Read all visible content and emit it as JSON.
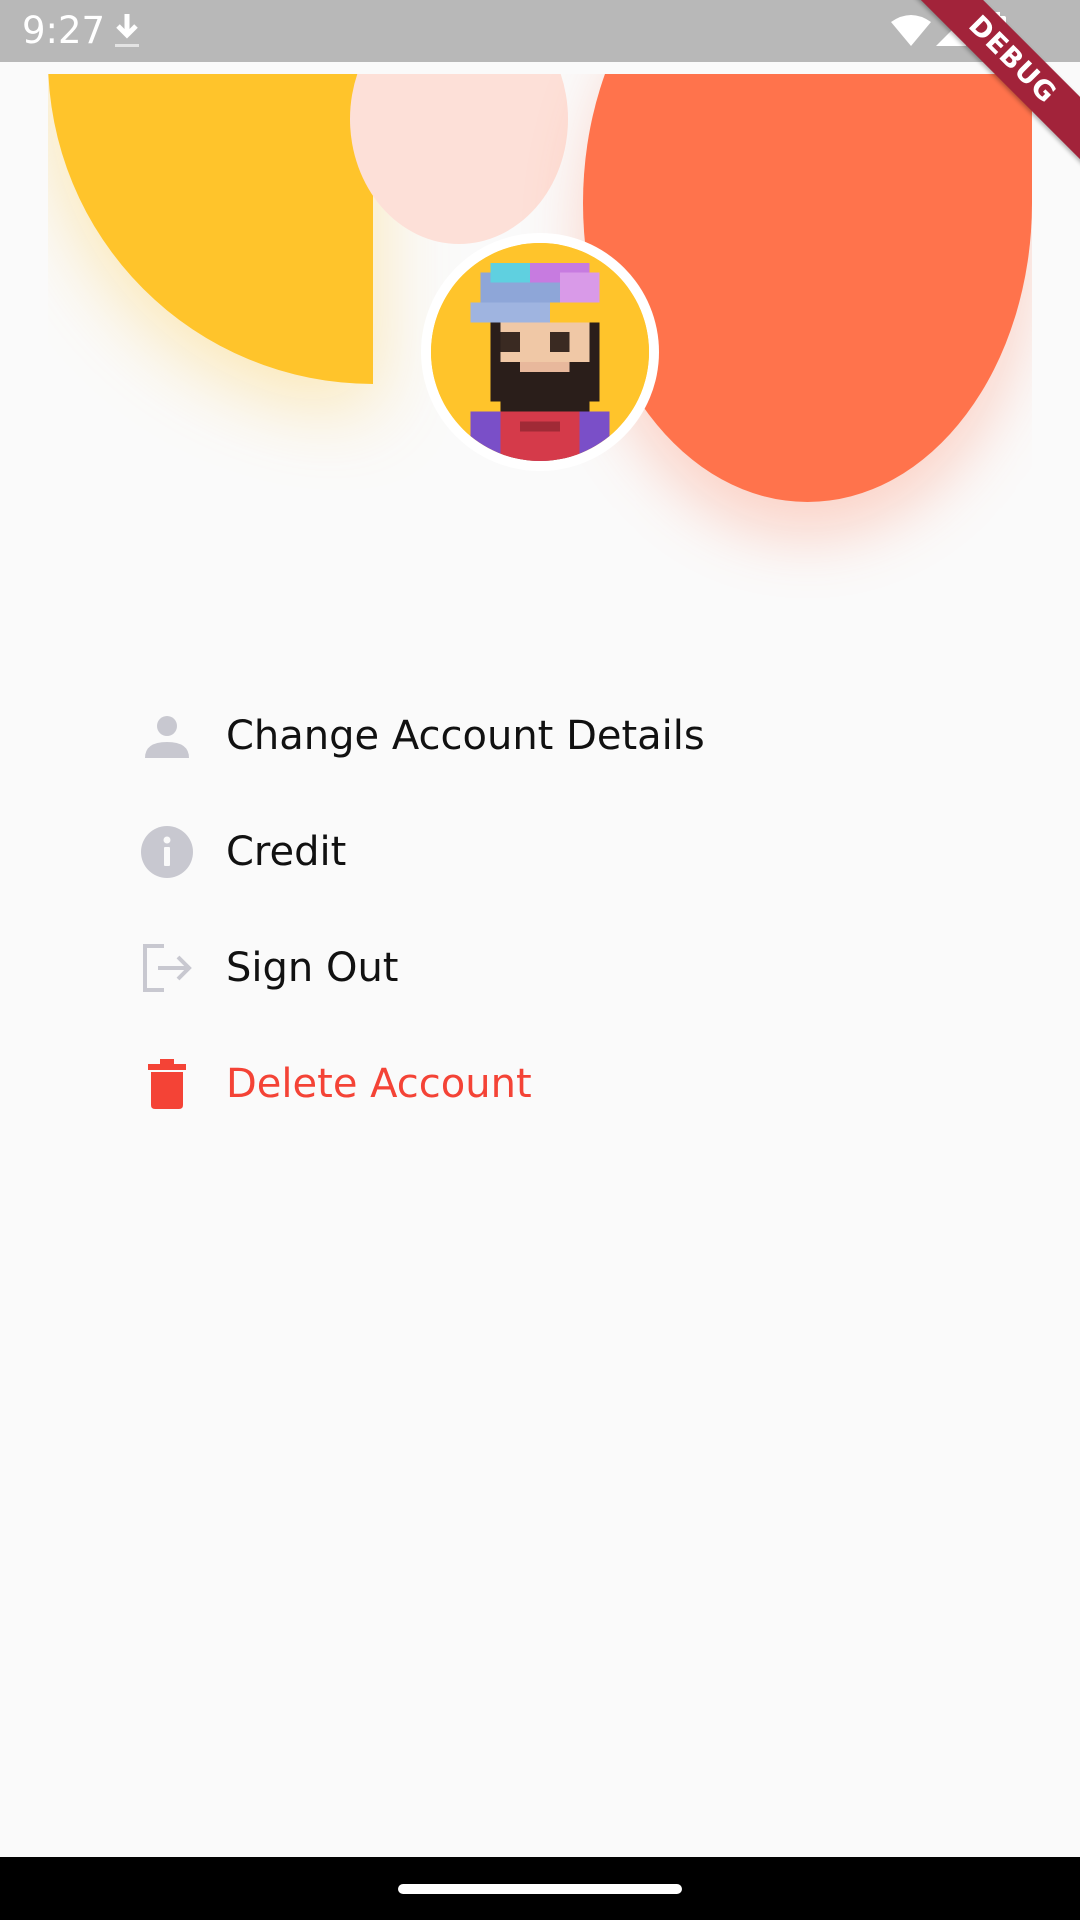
{
  "status_bar": {
    "time": "9:27",
    "icons": [
      "download-icon",
      "wifi-icon",
      "signal-icon",
      "battery-icon"
    ]
  },
  "debug_banner": {
    "label": "DEBUG"
  },
  "header": {
    "colors": {
      "yellow": "#ffc42b",
      "orange": "#ff734c",
      "pink": "#fde0d8"
    },
    "avatar_icon": "pixel-avatar"
  },
  "menu": {
    "items": [
      {
        "icon": "person-icon",
        "label": "Change Account Details",
        "color": "#111111"
      },
      {
        "icon": "info-icon",
        "label": "Credit",
        "color": "#111111"
      },
      {
        "icon": "sign-out-icon",
        "label": "Sign Out",
        "color": "#111111"
      },
      {
        "icon": "trash-icon",
        "label": "Delete Account",
        "color": "#f44336"
      }
    ],
    "icon_color": "#c8c8d0",
    "danger_color": "#f44336"
  }
}
